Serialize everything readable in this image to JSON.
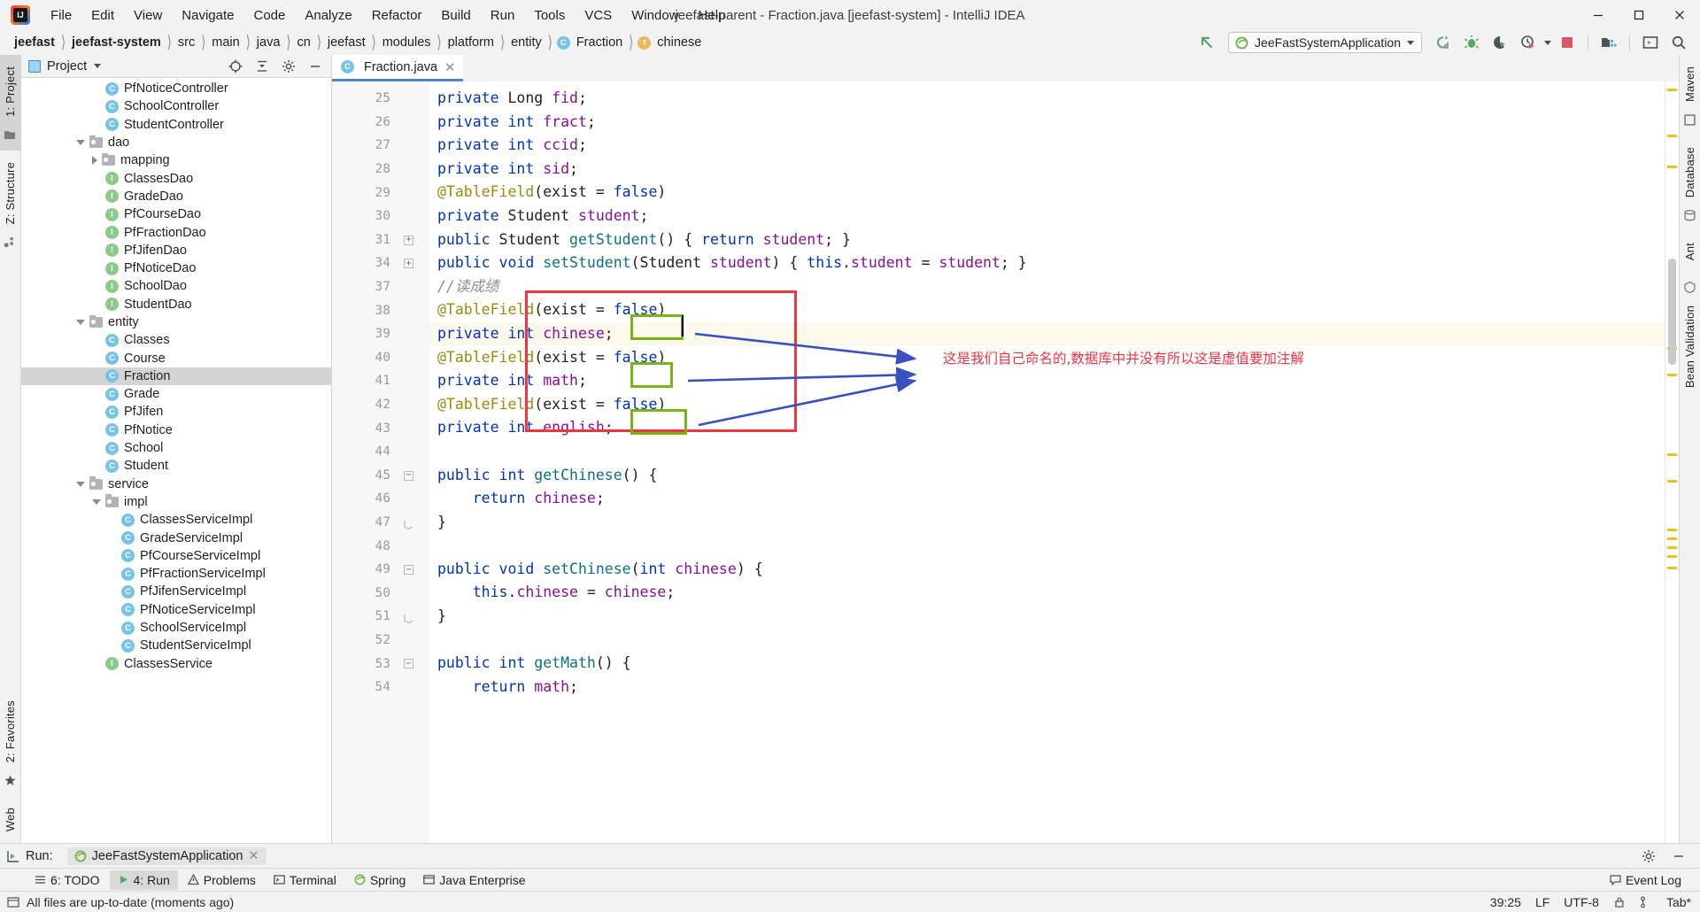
{
  "window": {
    "title": "jeefast-parent - Fraction.java [jeefast-system] - IntelliJ IDEA",
    "logo_name": "intellij-idea-logo"
  },
  "menubar": {
    "items": [
      "File",
      "Edit",
      "View",
      "Navigate",
      "Code",
      "Analyze",
      "Refactor",
      "Build",
      "Run",
      "Tools",
      "VCS",
      "Window",
      "Help"
    ]
  },
  "window_controls": {
    "minimize": "–",
    "maximize": "□",
    "close": "✕"
  },
  "breadcrumb": {
    "items": [
      {
        "label": "jeefast",
        "bold": true,
        "icon": ""
      },
      {
        "label": "jeefast-system",
        "bold": true,
        "icon": ""
      },
      {
        "label": "src",
        "bold": false,
        "icon": ""
      },
      {
        "label": "main",
        "bold": false,
        "icon": ""
      },
      {
        "label": "java",
        "bold": false,
        "icon": ""
      },
      {
        "label": "cn",
        "bold": false,
        "icon": ""
      },
      {
        "label": "jeefast",
        "bold": false,
        "icon": ""
      },
      {
        "label": "modules",
        "bold": false,
        "icon": ""
      },
      {
        "label": "platform",
        "bold": false,
        "icon": ""
      },
      {
        "label": "entity",
        "bold": false,
        "icon": ""
      },
      {
        "label": "Fraction",
        "bold": false,
        "icon": "C"
      },
      {
        "label": "chinese",
        "bold": false,
        "icon": "f"
      }
    ]
  },
  "toolbar": {
    "run_config": "JeeFastSystemApplication",
    "icons": [
      "back-arrow-icon",
      "rerun-icon",
      "debug-icon",
      "coverage-icon",
      "profiler-icon",
      "stop-icon",
      "project-structure-icon",
      "terminal-icon",
      "search-everywhere-icon"
    ]
  },
  "rails": {
    "left_top": "1: Project",
    "left_structure": "Z: Structure",
    "left_bottom": "2: Favorites",
    "left_web": "Web",
    "right": [
      "m",
      "Maven",
      "Database",
      "Ant",
      "Bean Validation"
    ]
  },
  "project_panel": {
    "title": "Project",
    "tree": [
      {
        "indent": 4,
        "icon": "class",
        "label": "PfNoticeController",
        "expander": "none",
        "selected": false
      },
      {
        "indent": 4,
        "icon": "class",
        "label": "SchoolController",
        "expander": "none",
        "selected": false
      },
      {
        "indent": 4,
        "icon": "class",
        "label": "StudentController",
        "expander": "none",
        "selected": false
      },
      {
        "indent": 3,
        "icon": "folder",
        "label": "dao",
        "expander": "down",
        "selected": false
      },
      {
        "indent": 4,
        "icon": "folder",
        "label": "mapping",
        "expander": "right",
        "selected": false
      },
      {
        "indent": 4,
        "icon": "iface",
        "label": "ClassesDao",
        "expander": "none",
        "selected": false
      },
      {
        "indent": 4,
        "icon": "iface",
        "label": "GradeDao",
        "expander": "none",
        "selected": false
      },
      {
        "indent": 4,
        "icon": "iface",
        "label": "PfCourseDao",
        "expander": "none",
        "selected": false
      },
      {
        "indent": 4,
        "icon": "iface",
        "label": "PfFractionDao",
        "expander": "none",
        "selected": false
      },
      {
        "indent": 4,
        "icon": "iface",
        "label": "PfJifenDao",
        "expander": "none",
        "selected": false
      },
      {
        "indent": 4,
        "icon": "iface",
        "label": "PfNoticeDao",
        "expander": "none",
        "selected": false
      },
      {
        "indent": 4,
        "icon": "iface",
        "label": "SchoolDao",
        "expander": "none",
        "selected": false
      },
      {
        "indent": 4,
        "icon": "iface",
        "label": "StudentDao",
        "expander": "none",
        "selected": false
      },
      {
        "indent": 3,
        "icon": "folder",
        "label": "entity",
        "expander": "down",
        "selected": false
      },
      {
        "indent": 4,
        "icon": "class",
        "label": "Classes",
        "expander": "none",
        "selected": false
      },
      {
        "indent": 4,
        "icon": "class",
        "label": "Course",
        "expander": "none",
        "selected": false
      },
      {
        "indent": 4,
        "icon": "class",
        "label": "Fraction",
        "expander": "none",
        "selected": true
      },
      {
        "indent": 4,
        "icon": "class",
        "label": "Grade",
        "expander": "none",
        "selected": false
      },
      {
        "indent": 4,
        "icon": "class",
        "label": "PfJifen",
        "expander": "none",
        "selected": false
      },
      {
        "indent": 4,
        "icon": "class",
        "label": "PfNotice",
        "expander": "none",
        "selected": false
      },
      {
        "indent": 4,
        "icon": "class",
        "label": "School",
        "expander": "none",
        "selected": false
      },
      {
        "indent": 4,
        "icon": "class",
        "label": "Student",
        "expander": "none",
        "selected": false
      },
      {
        "indent": 3,
        "icon": "folder",
        "label": "service",
        "expander": "down",
        "selected": false
      },
      {
        "indent": 4,
        "icon": "folder",
        "label": "impl",
        "expander": "down",
        "selected": false
      },
      {
        "indent": 5,
        "icon": "class",
        "label": "ClassesServiceImpl",
        "expander": "none",
        "selected": false
      },
      {
        "indent": 5,
        "icon": "class",
        "label": "GradeServiceImpl",
        "expander": "none",
        "selected": false
      },
      {
        "indent": 5,
        "icon": "class",
        "label": "PfCourseServiceImpl",
        "expander": "none",
        "selected": false
      },
      {
        "indent": 5,
        "icon": "class",
        "label": "PfFractionServiceImpl",
        "expander": "none",
        "selected": false
      },
      {
        "indent": 5,
        "icon": "class",
        "label": "PfJifenServiceImpl",
        "expander": "none",
        "selected": false
      },
      {
        "indent": 5,
        "icon": "class",
        "label": "PfNoticeServiceImpl",
        "expander": "none",
        "selected": false
      },
      {
        "indent": 5,
        "icon": "class",
        "label": "SchoolServiceImpl",
        "expander": "none",
        "selected": false
      },
      {
        "indent": 5,
        "icon": "class",
        "label": "StudentServiceImpl",
        "expander": "none",
        "selected": false
      },
      {
        "indent": 4,
        "icon": "iface",
        "label": "ClassesService",
        "expander": "none",
        "selected": false
      }
    ]
  },
  "editor": {
    "tab": {
      "label": "Fraction.java",
      "icon": "C",
      "close": "✕"
    },
    "line_numbers": [
      "25",
      "26",
      "27",
      "28",
      "29",
      "30",
      "31",
      "34",
      "37",
      "38",
      "39",
      "40",
      "41",
      "42",
      "43",
      "44",
      "45",
      "46",
      "47",
      "48",
      "49",
      "50",
      "51",
      "52",
      "53",
      "54"
    ],
    "lines": [
      {
        "n": "25",
        "fold": "none"
      },
      {
        "n": "26",
        "fold": "none"
      },
      {
        "n": "27",
        "fold": "none"
      },
      {
        "n": "28",
        "fold": "none"
      },
      {
        "n": "29",
        "fold": "none"
      },
      {
        "n": "30",
        "fold": "none"
      },
      {
        "n": "31",
        "fold": "plus"
      },
      {
        "n": "34",
        "fold": "plus"
      },
      {
        "n": "37",
        "fold": "none"
      },
      {
        "n": "38",
        "fold": "none"
      },
      {
        "n": "39",
        "fold": "none"
      },
      {
        "n": "40",
        "fold": "none"
      },
      {
        "n": "41",
        "fold": "none"
      },
      {
        "n": "42",
        "fold": "none"
      },
      {
        "n": "43",
        "fold": "none"
      },
      {
        "n": "44",
        "fold": "none"
      },
      {
        "n": "45",
        "fold": "minus"
      },
      {
        "n": "46",
        "fold": "none"
      },
      {
        "n": "47",
        "fold": "end"
      },
      {
        "n": "48",
        "fold": "none"
      },
      {
        "n": "49",
        "fold": "minus"
      },
      {
        "n": "50",
        "fold": "none"
      },
      {
        "n": "51",
        "fold": "end"
      },
      {
        "n": "52",
        "fold": "none"
      },
      {
        "n": "53",
        "fold": "minus"
      },
      {
        "n": "54",
        "fold": "none"
      }
    ],
    "code_text": [
      "private Long fid;",
      "private int fract;",
      "private int ccid;",
      "private int sid;",
      "@TableField(exist = false)",
      "private Student student;",
      "public Student getStudent() { return student; }",
      "public void setStudent(Student student) { this.student = student; }",
      "//读成绩",
      "@TableField(exist = false)",
      "private int chinese;",
      "@TableField(exist = false)",
      "private int math;",
      "@TableField(exist = false)",
      "private int english;",
      "",
      "public int getChinese() {",
      "    return chinese;",
      "}",
      "",
      "public void setChinese(int chinese) {",
      "    this.chinese = chinese;",
      "}",
      "",
      "public int getMath() {",
      "    return math;"
    ],
    "annotation_note": "这是我们自己命名的,数据库中并没有所以这是虚值要加注解",
    "colors": {
      "red_box": "#f5333f",
      "green_box": "#7ab317",
      "arrow_blue": "#3a4fc0",
      "note_red": "#f5333f",
      "keyword": "#0033b3",
      "field": "#871094",
      "method": "#0b7185",
      "annotation": "#9e880d",
      "comment": "#8c8c8c",
      "highlight_line": "#fcf9ec"
    }
  },
  "run_panel": {
    "label": "Run:",
    "tab": "JeeFastSystemApplication",
    "close": "✕"
  },
  "bottom_tabs": [
    {
      "label": "6: TODO",
      "icon": "todo-icon",
      "active": false
    },
    {
      "label": "4: Run",
      "icon": "run-icon",
      "active": true
    },
    {
      "label": "Problems",
      "icon": "problems-icon",
      "active": false
    },
    {
      "label": "Terminal",
      "icon": "terminal-icon",
      "active": false
    },
    {
      "label": "Spring",
      "icon": "spring-icon",
      "active": false
    },
    {
      "label": "Java Enterprise",
      "icon": "java-enterprise-icon",
      "active": false
    }
  ],
  "bottom_right": {
    "event_log": "Event Log"
  },
  "statusbar": {
    "message": "All files are up-to-date (moments ago)",
    "position": "39:25",
    "line_separator": "LF",
    "encoding": "UTF-8",
    "indent": "Tab*"
  }
}
